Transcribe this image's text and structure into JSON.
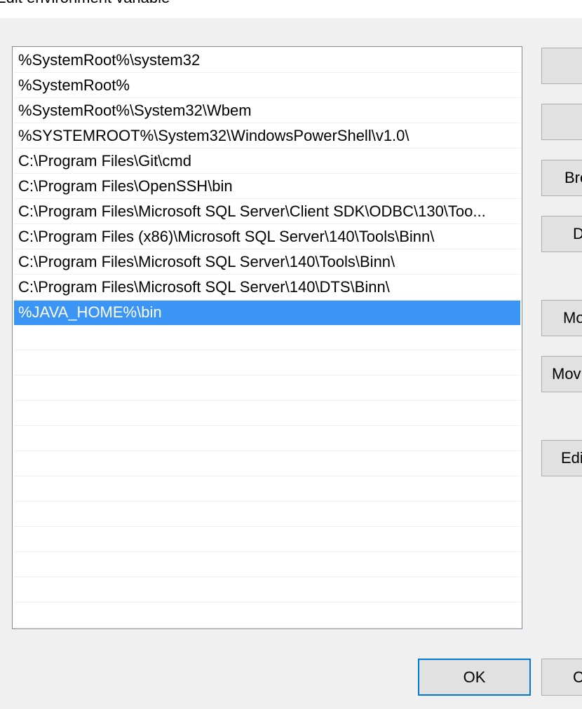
{
  "window": {
    "title": "Edit environment variable"
  },
  "list": {
    "items": [
      "%SystemRoot%\\system32",
      "%SystemRoot%",
      "%SystemRoot%\\System32\\Wbem",
      "%SYSTEMROOT%\\System32\\WindowsPowerShell\\v1.0\\",
      "C:\\Program Files\\Git\\cmd",
      "C:\\Program Files\\OpenSSH\\bin",
      "C:\\Program Files\\Microsoft SQL Server\\Client SDK\\ODBC\\130\\Too...",
      "C:\\Program Files (x86)\\Microsoft SQL Server\\140\\Tools\\Binn\\",
      "C:\\Program Files\\Microsoft SQL Server\\140\\Tools\\Binn\\",
      "C:\\Program Files\\Microsoft SQL Server\\140\\DTS\\Binn\\",
      "%JAVA_HOME%\\bin"
    ],
    "selected_index": 10,
    "selection_color": "#3a95f5"
  },
  "side_buttons": {
    "new_label": "",
    "edit_label": "",
    "browse_label": "Bro",
    "delete_label": "D",
    "move_up_label": "Mo",
    "move_down_label": "Mov",
    "edit_text_label": "Edi"
  },
  "footer": {
    "ok_label": "OK",
    "cancel_label": "C"
  }
}
